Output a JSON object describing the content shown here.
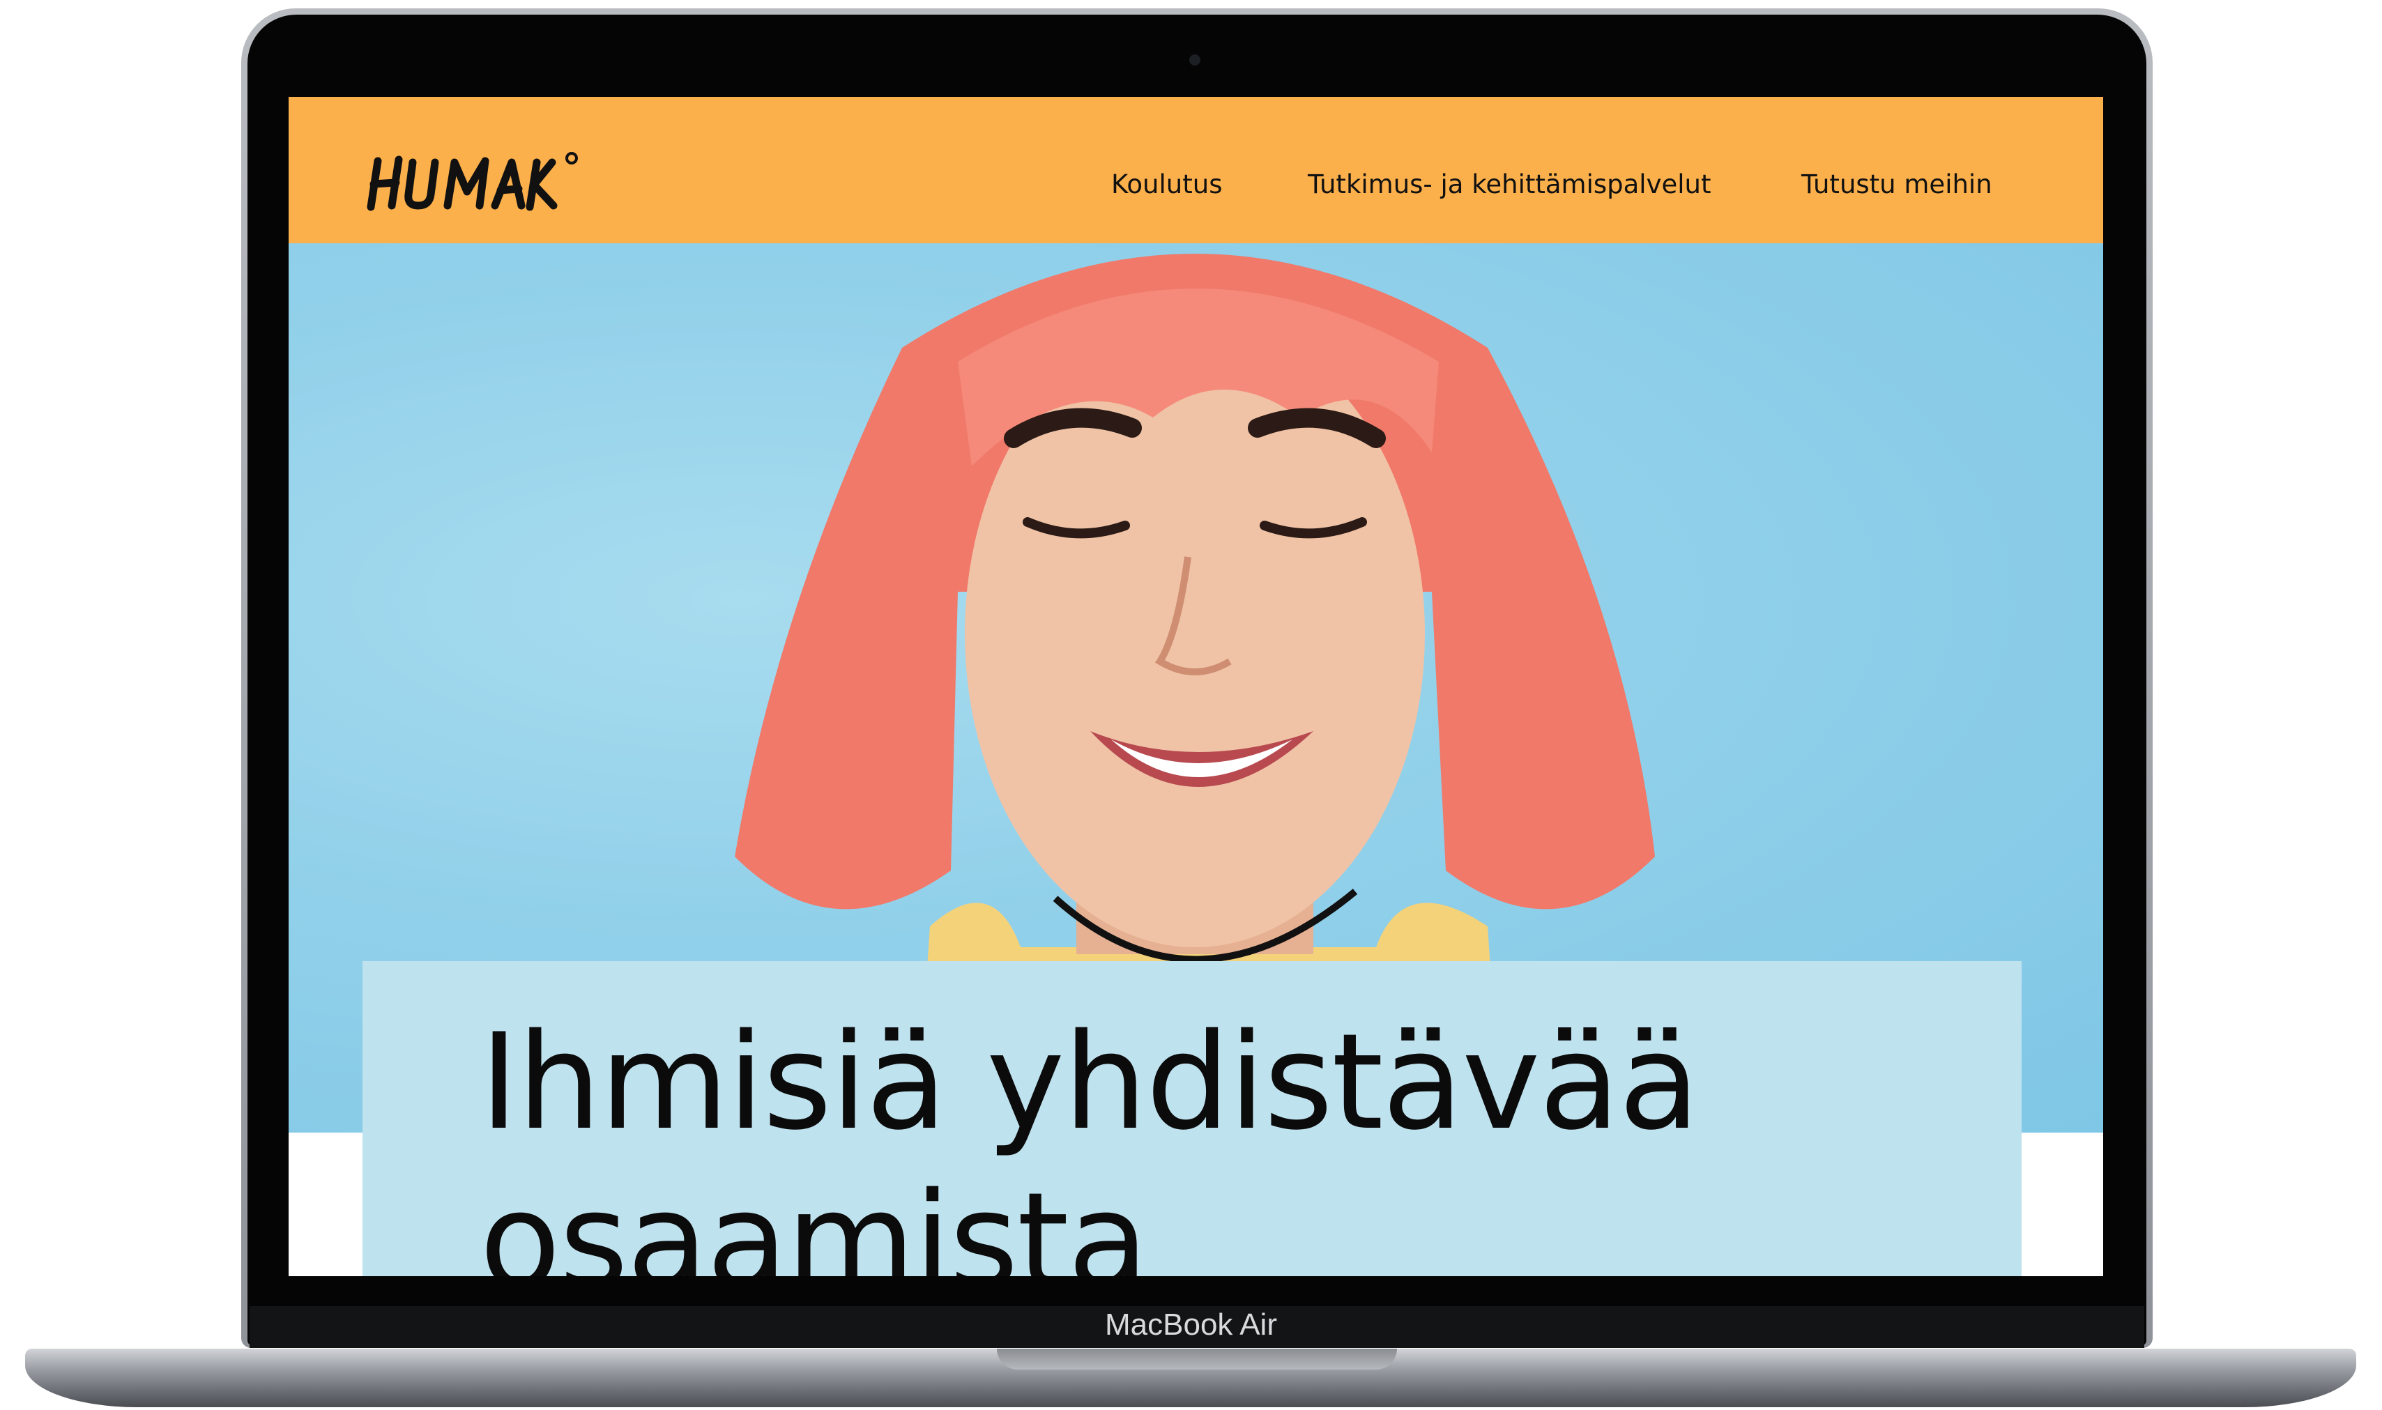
{
  "device": {
    "model_label": "MacBook Air"
  },
  "site": {
    "logo_text": "HUMAK",
    "nav": [
      {
        "label": "Koulutus"
      },
      {
        "label": "Tutkimus- ja kehittämispalvelut"
      },
      {
        "label": "Tutustu meihin"
      }
    ],
    "hero": {
      "image": "smiling-woman-with-pink-hair-photo",
      "headline": "Ihmisiä yhdistävää osaamista"
    }
  },
  "colors": {
    "header_bg": "#fcb04b",
    "hero_bg": "#93d1ea",
    "headline_box_bg": "#bfe2ef",
    "text": "#0b0b0b"
  }
}
